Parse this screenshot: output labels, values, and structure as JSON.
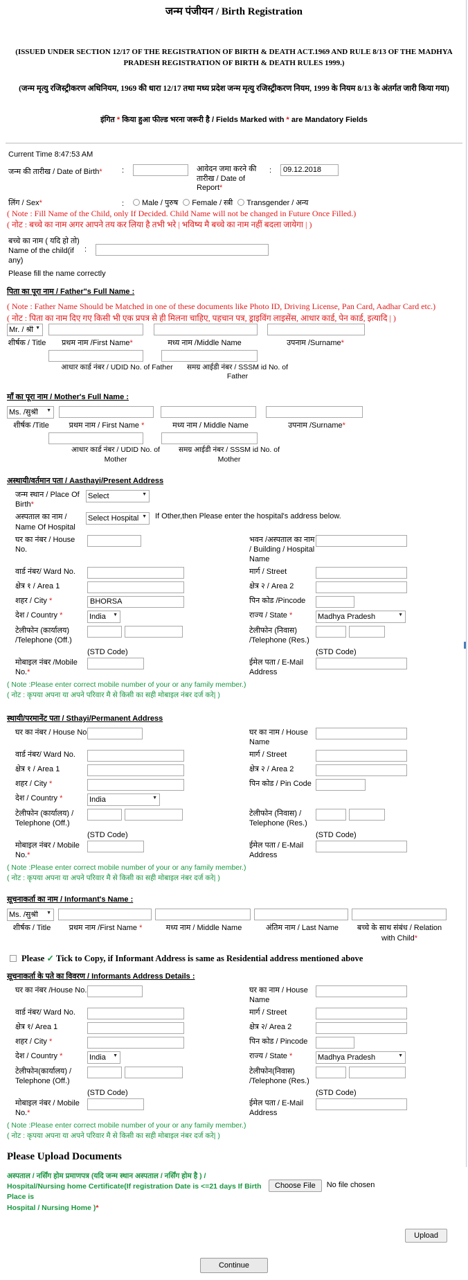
{
  "header": {
    "title": "जन्म पंजीयन / Birth Registration",
    "act_english": "(ISSUED UNDER SECTION 12/17 OF THE REGISTRATION OF BIRTH & DEATH ACT.1969 AND RULE 8/13 OF THE MADHYA PRADESH REGISTRATION OF BIRTH & DEATH RULES 1999.)",
    "act_hindi": "(जन्म मृत्यु रजिस्ट्रीकरण अधिनियम, 1969 की धारा 12/17 तथा मध्य प्रदेश जन्म मृत्यु रजिस्ट्रीकरण नियम, 1999 के नियम 8/13 के अंतर्गत जारी किया गया)",
    "mandatory_pre": "इंगित",
    "mandatory_mid": "किया हुआ फील्ड भरना जरूरी है / Fields Marked with",
    "mandatory_post": "are Mandatory Fields"
  },
  "child": {
    "current_time": "Current Time 8:47:53 AM",
    "dob_label": "जन्म की तारीख / Date of Birth",
    "dob_value": "",
    "dor_label": "आवेदन जमा करने की तारीख / Date of Report",
    "dor_value": "09.12.2018",
    "sex_label": "लिंग / Sex",
    "sex_options": [
      "Male / पुरुष",
      "Female / स्त्री",
      "Transgender / अन्य"
    ],
    "note_en": "( Note : Fill Name of the Child, only If Decided. Child Name will not be changed in Future Once Filled.)",
    "note_hi": "( नोट : बच्चे का नाम अगर आपने तय कर लिया है तभी भरे | भविष्य मै बच्चे का नाम नहीं बदला जायेगा | )",
    "name_label_hi": "बच्चे का नाम ( यदि हो तो)",
    "name_label_en": "Name of the child(if any)",
    "name_value": "",
    "fill_correctly": "Please fill the name correctly"
  },
  "father": {
    "heading": "पिता का पूरा नाम / Father\"s Full Name :",
    "note_en": "( Note : Father Name Should be Matched in one of these documents like Photo ID, Driving License, Pan Card, Aadhar Card etc.)",
    "note_hi": "( नोट : पिता का नाम दिए गए किसी भी एक प्रपत्र से ही मिलना चाहिए, पहचान पत्र, ड्राइविंग लाइसेंस, आधार कार्ड, पेन कार्ड, इत्यादि | )",
    "title_value": "Mr. / श्री",
    "cap_title": "शीर्षक / Title",
    "cap_first": "प्रथम नाम /First Name",
    "cap_middle": "मध्य नाम /Middle Name",
    "cap_surname": "उपनाम /Surname",
    "cap_udid": "आधार कार्ड नंबर / UDID No. of Father",
    "cap_sssm": "समग्र आईडी नंबर / SSSM id No. of Father",
    "first_value": "",
    "middle_value": "",
    "surname_value": "",
    "udid_value": "",
    "sssm_value": ""
  },
  "mother": {
    "heading": "माँ का पूरा नाम / Mother's Full Name :",
    "title_value": "Ms. /सुश्री",
    "cap_title": "शीर्षक /Title",
    "cap_first": "प्रथम नाम / First Name",
    "cap_middle": "मध्य नाम / Middle Name",
    "cap_surname": "उपनाम /Surname",
    "cap_udid": "आधार कार्ड नंबर / UDID No. of Mother",
    "cap_sssm": "समग्र आईडी नंबर / SSSM id No. of Mother",
    "first_value": "",
    "middle_value": "",
    "surname_value": "",
    "udid_value": "",
    "sssm_value": ""
  },
  "present_address": {
    "heading": "अस्थायी/वर्तमान पता / Aasthayi/Present Address",
    "place_of_birth_label": "जन्म स्थान / Place Of Birth",
    "place_of_birth_value": "Select",
    "hospital_label": "अस्पताल का नाम / Name Of Hospital",
    "hospital_value": "Select Hospital",
    "hospital_hint": "If Other,then Please enter the hospital's address below.",
    "house_no_label": "घर का नंबर / House No.",
    "house_no_value": "",
    "building_label": "भवन /अस्पताल का नाम / Building / Hospital Name",
    "building_value": "",
    "ward_label": "वार्ड नंबर/ Ward No.",
    "ward_value": "",
    "street_label": "मार्ग / Street",
    "street_value": "",
    "area1_label": "क्षेत्र १ / Area 1",
    "area1_value": "",
    "area2_label": "क्षेत्र २ / Area 2",
    "area2_value": "",
    "city_label": "शहर / City",
    "city_value": "BHORSA",
    "pincode_label": "पिन कोड /Pincode",
    "pincode_value": "",
    "country_label": "देश / Country",
    "country_value": "India",
    "state_label": "राज्य / State",
    "state_value": "Madhya Pradesh",
    "tel_off_label": "टेलीफोन (कार्यालय) /Telephone (Off.)",
    "tel_res_label": "टेलीफोन (निवास) /Telephone (Res.)",
    "std_code": "(STD Code)",
    "mobile_label": "मोबाइल नंबर /Mobile No.",
    "mobile_value": "",
    "email_label": "ईमेल पता / E-Mail Address",
    "email_value": "",
    "note_en": "( Note :Please enter correct mobile number of your or any family member.)",
    "note_hi": "( नोट : कृपया अपना या अपने परिवार मै से किसी का सही मोबाइल नंबर दर्ज करे| )"
  },
  "permanent_address": {
    "heading": "स्थायी/परमानेंट पता / Sthayi/Permanent Address",
    "house_no_label": "घर का नंबर / House No",
    "house_no_value": "",
    "house_name_label": "घर का नाम / House Name",
    "house_name_value": "",
    "ward_label": "वार्ड नंबर/ Ward No.",
    "ward_value": "",
    "street_label": "मार्ग / Street",
    "street_value": "",
    "area1_label": "क्षेत्र १ / Area 1",
    "area1_value": "",
    "area2_label": "क्षेत्र २ / Area 2",
    "area2_value": "",
    "city_label": "शहर / City",
    "city_value": "",
    "pincode_label": "पिन कोड / Pin Code",
    "pincode_value": "",
    "country_label": "देश / Country",
    "country_value": "India",
    "tel_off_label": "टेलीफोन (कार्यालय) / Telephone (Off.)",
    "tel_res_label": "टेलीफोन (निवास) / Telephone (Res.)",
    "std_code": "(STD Code)",
    "mobile_label": "मोबाइल नंबर / Mobile No.",
    "mobile_value": "",
    "email_label": "ईमेल पता / E-Mail Address",
    "email_value": "",
    "note_en": "( Note :Please enter correct mobile number of your or any family member.)",
    "note_hi": "( नोट : कृपया अपना या अपने परिवार मै से किसी का सही मोबाइल नंबर दर्ज करे| )"
  },
  "informant": {
    "heading": "सूचनाकर्ता का नाम / Informant's Name :",
    "title_value": "Ms. /सुश्री",
    "cap_title": "शीर्षक / Title",
    "cap_first": "प्रथम नाम /First Name",
    "cap_middle": "मध्य नाम / Middle Name",
    "cap_last": "अंतिम नाम / Last Name",
    "cap_relation": "बच्चे के साथ संबंध / Relation with Child",
    "first_value": "",
    "middle_value": "",
    "last_value": "",
    "relation_value": "",
    "copy_text_pre": "Please",
    "copy_tick": "✓",
    "copy_text_post": "Tick to Copy, if Informant Address is same as Residential address mentioned above"
  },
  "informant_address": {
    "heading": "सूचनाकर्ता के पते का विवरण / Informants Address Details :",
    "house_no_label": "घर का नंबर /House No.",
    "house_no_value": "",
    "house_name_label": "घर का नाम / House Name",
    "house_name_value": "",
    "ward_label": "वार्ड नंबर/ Ward No.",
    "ward_value": "",
    "street_label": "मार्ग / Street",
    "street_value": "",
    "area1_label": "क्षेत्र १/ Area 1",
    "area1_value": "",
    "area2_label": "क्षेत्र २/ Area 2",
    "area2_value": "",
    "city_label": "शहर / City",
    "city_value": "",
    "pincode_label": "पिन कोड / Pincode",
    "pincode_value": "",
    "country_label": "देश / Country",
    "country_value": "India",
    "state_label": "राज्य / State",
    "state_value": "Madhya Pradesh",
    "tel_off_label": "टेलीफोन(कार्यालय) / Telephone (Off.)",
    "tel_res_label": "टेलीफोन(निवास) /Telephone (Res.)",
    "std_code": "(STD Code)",
    "mobile_label": "मोबाइल नंबर / Mobile No.",
    "mobile_value": "",
    "email_label": "ईमेल पता / E-Mail Address",
    "email_value": "",
    "note_en": "( Note :Please enter correct mobile number of your or any family member.)",
    "note_hi": "( नोट : कृपया अपना या अपने परिवार मै से किसी का सही मोबाइल नंबर दर्ज करे| )"
  },
  "upload": {
    "heading": "Please Upload Documents",
    "doc_label_line1": "अस्पताल / नर्सिंग होम प्रमाणपत्र (यदि जन्म स्थान अस्पताल / नर्सिंग होम है ) /",
    "doc_label_line2": "Hospital/Nursing home Certificate(If registration Date is <=21 days If Birth Place is",
    "doc_label_line3": "Hospital / Nursing Home )",
    "choose_file": "Choose File",
    "no_file": "No file chosen",
    "upload_button": "Upload",
    "continue_button": "Continue"
  },
  "colors": {
    "red": "#e21b1b",
    "green": "#1a9641",
    "border": "#a9a9a9"
  }
}
